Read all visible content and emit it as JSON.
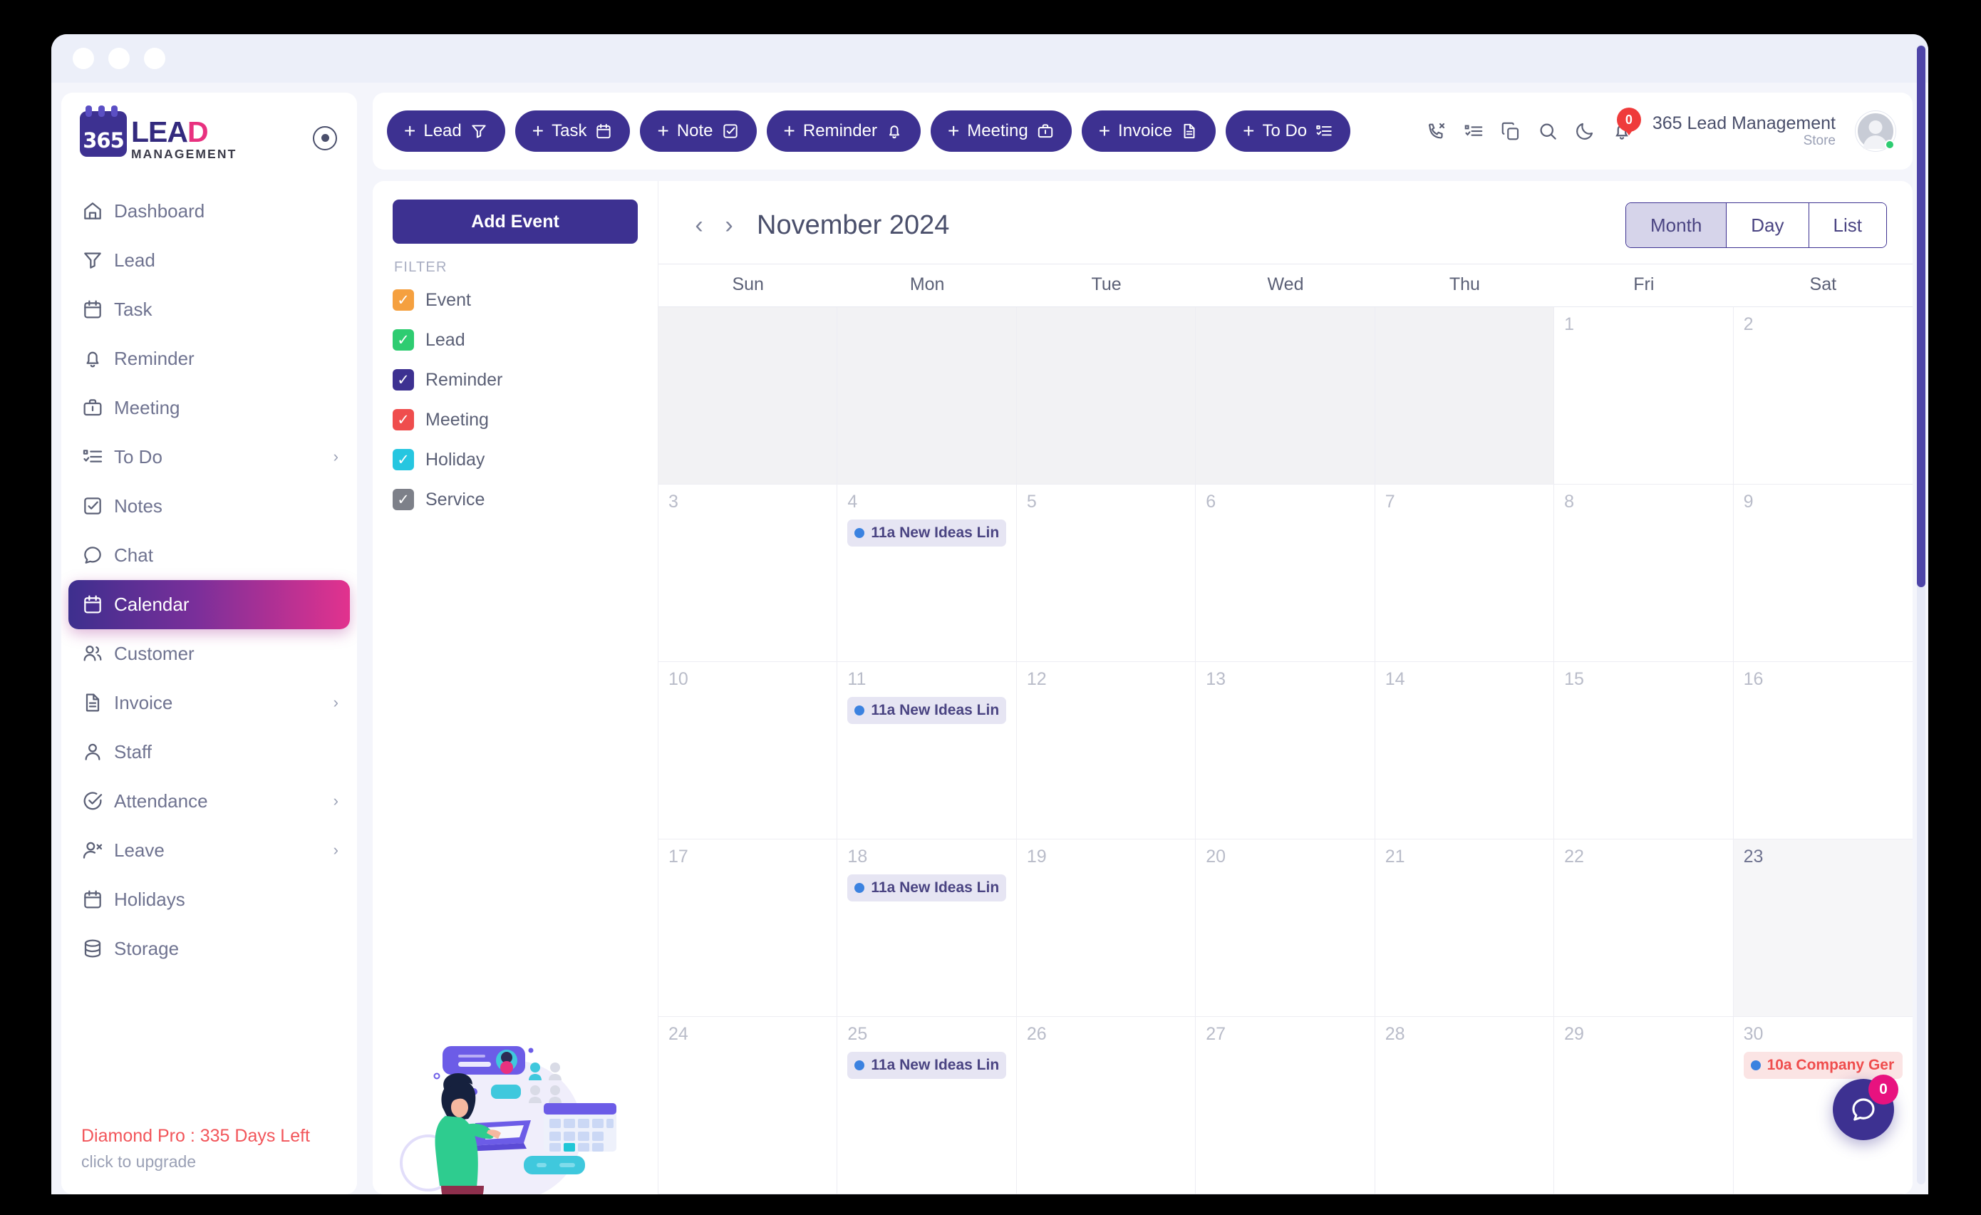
{
  "window": {
    "dots": [
      "close",
      "minimize",
      "maximize"
    ]
  },
  "brand": {
    "badge_text": "365",
    "name_main": "LEA",
    "name_accent": "D",
    "subtitle": "MANAGEMENT"
  },
  "sidebar": {
    "items": [
      {
        "label": "Dashboard",
        "icon": "home-icon",
        "has_chevron": false,
        "active": false
      },
      {
        "label": "Lead",
        "icon": "funnel-icon",
        "has_chevron": false,
        "active": false
      },
      {
        "label": "Task",
        "icon": "calendar-icon",
        "has_chevron": false,
        "active": false
      },
      {
        "label": "Reminder",
        "icon": "bell-icon",
        "has_chevron": false,
        "active": false
      },
      {
        "label": "Meeting",
        "icon": "briefcase-icon",
        "has_chevron": false,
        "active": false
      },
      {
        "label": "To Do",
        "icon": "checklist-icon",
        "has_chevron": true,
        "active": false
      },
      {
        "label": "Notes",
        "icon": "note-check-icon",
        "has_chevron": false,
        "active": false
      },
      {
        "label": "Chat",
        "icon": "chat-bubble-icon",
        "has_chevron": false,
        "active": false
      },
      {
        "label": "Calendar",
        "icon": "calendar-icon",
        "has_chevron": false,
        "active": true
      },
      {
        "label": "Customer",
        "icon": "users-icon",
        "has_chevron": false,
        "active": false
      },
      {
        "label": "Invoice",
        "icon": "document-icon",
        "has_chevron": true,
        "active": false
      },
      {
        "label": "Staff",
        "icon": "user-icon",
        "has_chevron": false,
        "active": false
      },
      {
        "label": "Attendance",
        "icon": "check-circle-icon",
        "has_chevron": true,
        "active": false
      },
      {
        "label": "Leave",
        "icon": "user-remove-icon",
        "has_chevron": true,
        "active": false
      },
      {
        "label": "Holidays",
        "icon": "calendar-icon",
        "has_chevron": false,
        "active": false
      },
      {
        "label": "Storage",
        "icon": "database-icon",
        "has_chevron": false,
        "active": false
      }
    ],
    "footer": {
      "plan": "Diamond Pro : 335 Days Left",
      "upgrade": "click to upgrade"
    }
  },
  "topbar": {
    "quick_add": [
      {
        "label": "Lead",
        "icon": "funnel-icon"
      },
      {
        "label": "Task",
        "icon": "calendar-icon"
      },
      {
        "label": "Note",
        "icon": "note-check-icon"
      },
      {
        "label": "Reminder",
        "icon": "bell-icon"
      },
      {
        "label": "Meeting",
        "icon": "briefcase-icon"
      },
      {
        "label": "Invoice",
        "icon": "document-icon"
      },
      {
        "label": "To Do",
        "icon": "checklist-icon"
      }
    ],
    "plus": "+",
    "icons": [
      "missed-call-icon",
      "checklist-icon",
      "copy-icon",
      "search-icon",
      "moon-icon"
    ],
    "notification_count": "0",
    "account": {
      "name": "365 Lead Management",
      "role": "Store"
    }
  },
  "calendar_panel": {
    "add_event_label": "Add Event",
    "filter_title": "FILTER",
    "filters": [
      {
        "label": "Event",
        "color": "#f5a03f",
        "checked": true
      },
      {
        "label": "Lead",
        "color": "#2ecc71",
        "checked": true
      },
      {
        "label": "Reminder",
        "color": "#3d3191",
        "checked": true
      },
      {
        "label": "Meeting",
        "color": "#ef4d4d",
        "checked": true
      },
      {
        "label": "Holiday",
        "color": "#26c6e0",
        "checked": true
      },
      {
        "label": "Service",
        "color": "#7d8089",
        "checked": true
      }
    ]
  },
  "calendar": {
    "title": "November 2024",
    "prev_label": "‹",
    "next_label": "›",
    "views": [
      {
        "label": "Month",
        "active": true
      },
      {
        "label": "Day",
        "active": false
      },
      {
        "label": "List",
        "active": false
      }
    ],
    "weekdays": [
      "Sun",
      "Mon",
      "Tue",
      "Wed",
      "Thu",
      "Fri",
      "Sat"
    ],
    "cells": [
      {
        "day": "",
        "out": true
      },
      {
        "day": "",
        "out": true
      },
      {
        "day": "",
        "out": true
      },
      {
        "day": "",
        "out": true
      },
      {
        "day": "",
        "out": true
      },
      {
        "day": "1"
      },
      {
        "day": "2"
      },
      {
        "day": "3"
      },
      {
        "day": "4",
        "events": [
          {
            "text": "11a New Ideas Lin",
            "type": "blue"
          }
        ]
      },
      {
        "day": "5"
      },
      {
        "day": "6"
      },
      {
        "day": "7"
      },
      {
        "day": "8"
      },
      {
        "day": "9"
      },
      {
        "day": "10"
      },
      {
        "day": "11",
        "events": [
          {
            "text": "11a New Ideas Lin",
            "type": "blue"
          }
        ]
      },
      {
        "day": "12"
      },
      {
        "day": "13"
      },
      {
        "day": "14"
      },
      {
        "day": "15"
      },
      {
        "day": "16"
      },
      {
        "day": "17"
      },
      {
        "day": "18",
        "events": [
          {
            "text": "11a New Ideas Lin",
            "type": "blue"
          }
        ]
      },
      {
        "day": "19"
      },
      {
        "day": "20"
      },
      {
        "day": "21"
      },
      {
        "day": "22"
      },
      {
        "day": "23",
        "today": true
      },
      {
        "day": "24"
      },
      {
        "day": "25",
        "events": [
          {
            "text": "11a New Ideas Lin",
            "type": "blue"
          }
        ]
      },
      {
        "day": "26"
      },
      {
        "day": "27"
      },
      {
        "day": "28"
      },
      {
        "day": "29"
      },
      {
        "day": "30",
        "events": [
          {
            "text": "10a Company Ger",
            "type": "red"
          }
        ]
      }
    ]
  },
  "chat_fab": {
    "badge": "0",
    "icon": "chat-bubble-icon"
  }
}
